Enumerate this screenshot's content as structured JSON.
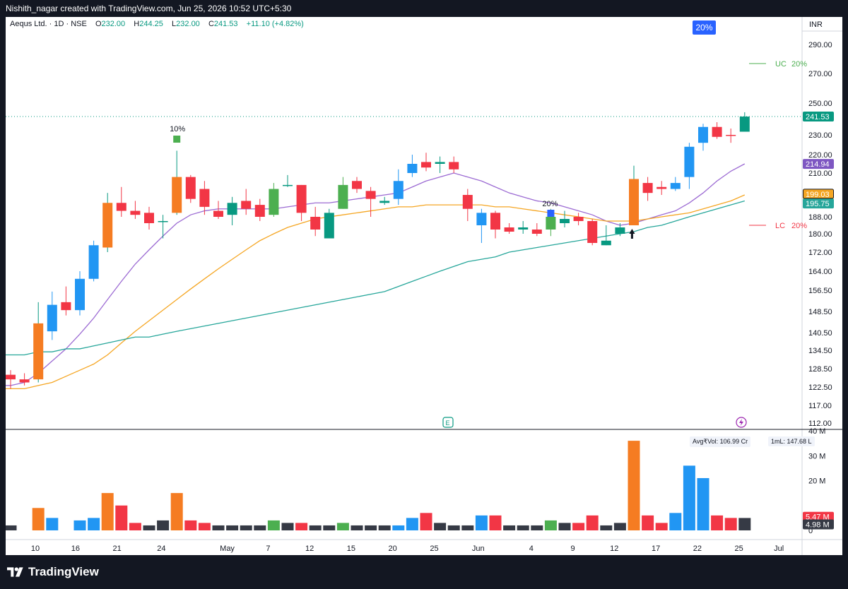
{
  "header": {
    "attribution": "Nishith_nagar created with TradingView.com, Jun 25, 2026 10:52 UTC+5:30"
  },
  "legend": {
    "symbol": "Aequs Ltd. · 1D · NSE",
    "o_label": "O",
    "o_value": "232.00",
    "h_label": "H",
    "h_value": "244.25",
    "l_label": "L",
    "l_value": "232.00",
    "c_label": "C",
    "c_value": "241.53",
    "change": "+11.10 (+4.82%)"
  },
  "badge": "20%",
  "currency": "INR",
  "footer": {
    "brand": "TradingView"
  },
  "colors": {
    "up": "#089981",
    "down": "#f23645",
    "orange": "#f57c22",
    "blue": "#2196f3",
    "green": "#4caf50",
    "sma_purple": "#9c6bd3",
    "sma_orange": "#f5a623",
    "sma_teal": "#26a69a",
    "vol_neutral": "#363a45"
  },
  "chart_data": {
    "type": "candlestick",
    "title": "Aequs Ltd. · 1D · NSE",
    "y_ticks": [
      "290.00",
      "270.00",
      "250.00",
      "230.00",
      "220.00",
      "210.00",
      "188.00",
      "180.00",
      "172.00",
      "164.00",
      "156.50",
      "148.50",
      "140.50",
      "134.50",
      "128.50",
      "122.50",
      "117.00",
      "112.00"
    ],
    "x_ticks": [
      "10",
      "16",
      "21",
      "24",
      "May",
      "7",
      "12",
      "15",
      "20",
      "25",
      "Jun",
      "4",
      "9",
      "12",
      "17",
      "22",
      "25",
      "Jul"
    ],
    "price_tags": [
      {
        "label": "241.53",
        "color": "#089981"
      },
      {
        "label": "214.94",
        "color": "#7e57c2"
      },
      {
        "label": "199.03",
        "color": "#f5a623"
      },
      {
        "label": "195.75",
        "color": "#26a69a"
      }
    ],
    "ohlc": [
      {
        "o": 126.5,
        "h": 128,
        "l": 122,
        "c": 125,
        "color": "down"
      },
      {
        "o": 125,
        "h": 127,
        "l": 123,
        "c": 124,
        "color": "down"
      },
      {
        "o": 125,
        "h": 152,
        "l": 124,
        "c": 144,
        "color": "orange"
      },
      {
        "o": 141,
        "h": 156,
        "l": 138,
        "c": 151,
        "color": "blue"
      },
      {
        "o": 152,
        "h": 158,
        "l": 147,
        "c": 149,
        "color": "down"
      },
      {
        "o": 149,
        "h": 164,
        "l": 147,
        "c": 161,
        "color": "blue"
      },
      {
        "o": 161,
        "h": 177,
        "l": 160,
        "c": 175,
        "color": "blue"
      },
      {
        "o": 174,
        "h": 200,
        "l": 172,
        "c": 195,
        "color": "orange"
      },
      {
        "o": 195,
        "h": 203,
        "l": 188,
        "c": 191,
        "color": "down"
      },
      {
        "o": 191,
        "h": 196,
        "l": 187,
        "c": 189,
        "color": "down"
      },
      {
        "o": 190,
        "h": 193,
        "l": 182,
        "c": 185,
        "color": "down"
      },
      {
        "o": 186,
        "h": 189,
        "l": 178,
        "c": 186,
        "color": "up"
      },
      {
        "o": 190,
        "h": 222,
        "l": 189,
        "c": 208,
        "color": "orange"
      },
      {
        "o": 208,
        "h": 209,
        "l": 195,
        "c": 197,
        "color": "down"
      },
      {
        "o": 202,
        "h": 206,
        "l": 189,
        "c": 193,
        "color": "down"
      },
      {
        "o": 191,
        "h": 196,
        "l": 187,
        "c": 188,
        "color": "down"
      },
      {
        "o": 189,
        "h": 198,
        "l": 184,
        "c": 195,
        "color": "up"
      },
      {
        "o": 196,
        "h": 202,
        "l": 189,
        "c": 192,
        "color": "down"
      },
      {
        "o": 194,
        "h": 197,
        "l": 186,
        "c": 188,
        "color": "down"
      },
      {
        "o": 189,
        "h": 205,
        "l": 188,
        "c": 202,
        "color": "green"
      },
      {
        "o": 204,
        "h": 209,
        "l": 203,
        "c": 204,
        "color": "up"
      },
      {
        "o": 204,
        "h": 204,
        "l": 186,
        "c": 190,
        "color": "down"
      },
      {
        "o": 188,
        "h": 193,
        "l": 179,
        "c": 182,
        "color": "down"
      },
      {
        "o": 178,
        "h": 192,
        "l": 178,
        "c": 190,
        "color": "up"
      },
      {
        "o": 192,
        "h": 208,
        "l": 192,
        "c": 204,
        "color": "green"
      },
      {
        "o": 206,
        "h": 208,
        "l": 200,
        "c": 202,
        "color": "down"
      },
      {
        "o": 201,
        "h": 203,
        "l": 188,
        "c": 197,
        "color": "down"
      },
      {
        "o": 196,
        "h": 198,
        "l": 194,
        "c": 195,
        "color": "up"
      },
      {
        "o": 197,
        "h": 212,
        "l": 194,
        "c": 206,
        "color": "blue"
      },
      {
        "o": 210,
        "h": 220,
        "l": 208,
        "c": 215,
        "color": "blue"
      },
      {
        "o": 216,
        "h": 221,
        "l": 211,
        "c": 213,
        "color": "down"
      },
      {
        "o": 216,
        "h": 219,
        "l": 210,
        "c": 215,
        "color": "up"
      },
      {
        "o": 216,
        "h": 219,
        "l": 210,
        "c": 212,
        "color": "down"
      },
      {
        "o": 199,
        "h": 202,
        "l": 186,
        "c": 192,
        "color": "down"
      },
      {
        "o": 184,
        "h": 192,
        "l": 176,
        "c": 190,
        "color": "blue"
      },
      {
        "o": 190,
        "h": 191,
        "l": 178,
        "c": 182,
        "color": "down"
      },
      {
        "o": 183,
        "h": 185,
        "l": 180,
        "c": 181,
        "color": "down"
      },
      {
        "o": 182,
        "h": 186,
        "l": 180,
        "c": 183,
        "color": "up"
      },
      {
        "o": 182,
        "h": 185,
        "l": 179,
        "c": 180,
        "color": "down"
      },
      {
        "o": 182,
        "h": 192,
        "l": 179,
        "c": 188,
        "color": "green"
      },
      {
        "o": 187,
        "h": 191,
        "l": 183,
        "c": 185,
        "color": "up"
      },
      {
        "o": 188,
        "h": 190,
        "l": 184,
        "c": 186,
        "color": "down"
      },
      {
        "o": 186,
        "h": 187,
        "l": 175,
        "c": 176,
        "color": "down"
      },
      {
        "o": 177,
        "h": 184,
        "l": 175,
        "c": 175,
        "color": "up"
      },
      {
        "o": 180,
        "h": 185,
        "l": 179,
        "c": 183,
        "color": "up"
      },
      {
        "o": 184,
        "h": 214,
        "l": 184,
        "c": 207,
        "color": "orange"
      },
      {
        "o": 205,
        "h": 208,
        "l": 196,
        "c": 200,
        "color": "down"
      },
      {
        "o": 203,
        "h": 206,
        "l": 199,
        "c": 202,
        "color": "down"
      },
      {
        "o": 202,
        "h": 208,
        "l": 201,
        "c": 205,
        "color": "blue"
      },
      {
        "o": 208,
        "h": 226,
        "l": 202,
        "c": 224,
        "color": "blue"
      },
      {
        "o": 226,
        "h": 237,
        "l": 222,
        "c": 235,
        "color": "blue"
      },
      {
        "o": 235,
        "h": 238,
        "l": 228,
        "c": 229,
        "color": "down"
      },
      {
        "o": 230,
        "h": 234,
        "l": 226,
        "c": 230,
        "color": "down"
      },
      {
        "o": 232,
        "h": 244.25,
        "l": 232,
        "c": 241.53,
        "color": "up"
      }
    ],
    "sma": [
      {
        "name": "SMA 10",
        "color": "#9c6bd3",
        "values": [
          123,
          124,
          127,
          131,
          135,
          140,
          146,
          153,
          160,
          167,
          173,
          179,
          185,
          189,
          191,
          192,
          192,
          192,
          192,
          192,
          193,
          194,
          195,
          195,
          196,
          197,
          198,
          199,
          200,
          203,
          206,
          208,
          210,
          208,
          206,
          203,
          200,
          198,
          196,
          195,
          193,
          191,
          189,
          186,
          184,
          185,
          187,
          189,
          191,
          195,
          200,
          206,
          211,
          215
        ]
      },
      {
        "name": "SMA 20",
        "color": "#f5a623",
        "values": [
          122,
          122,
          123,
          124,
          126,
          128,
          130,
          133,
          137,
          141,
          145,
          149,
          153,
          157,
          161,
          165,
          169,
          173,
          177,
          180,
          183,
          185,
          187,
          188,
          189,
          190,
          191,
          192,
          193,
          193,
          194,
          194,
          194,
          194,
          194,
          193,
          193,
          192,
          191,
          190,
          189,
          188,
          187,
          186,
          186,
          186,
          187,
          188,
          189,
          190,
          192,
          194,
          196,
          199
        ]
      },
      {
        "name": "SMA 50",
        "color": "#26a69a",
        "values": [
          133,
          133,
          134,
          134,
          135,
          135,
          136,
          137,
          138,
          139,
          139,
          140,
          141,
          142,
          143,
          144,
          145,
          146,
          147,
          148,
          149,
          150,
          151,
          152,
          153,
          154,
          155,
          156,
          158,
          160,
          162,
          164,
          166,
          168,
          169,
          170,
          172,
          173,
          174,
          175,
          176,
          177,
          178,
          179,
          180,
          181,
          183,
          184,
          186,
          188,
          190,
          192,
          194,
          196
        ]
      }
    ],
    "volume": {
      "unit": "M",
      "axis_ticks": [
        "40 M",
        "30 M",
        "20 M",
        "0"
      ],
      "tags": [
        "5.47 M",
        "4.98 M"
      ],
      "avg_label": "Avg₹Vol: 106.99 Cr",
      "ml_label": "1mL: 147.68 L",
      "values": [
        2,
        0,
        9,
        5,
        0,
        4,
        5,
        15,
        10,
        3,
        2,
        4,
        15,
        4,
        3,
        2,
        2,
        2,
        2,
        4,
        3,
        3,
        2,
        2,
        3,
        2,
        2,
        2,
        2,
        5,
        7,
        3,
        2,
        2,
        6,
        6,
        2,
        2,
        2,
        4,
        3,
        3,
        6,
        2,
        3,
        36,
        6,
        3,
        7,
        26,
        21,
        6,
        5,
        4.98
      ]
    },
    "annotations": [
      {
        "text": "10%",
        "index": 12
      },
      {
        "text": "20%",
        "index": 39
      },
      {
        "text": "UC",
        "value": "20%"
      },
      {
        "text": "LC",
        "value": "20%"
      }
    ]
  }
}
